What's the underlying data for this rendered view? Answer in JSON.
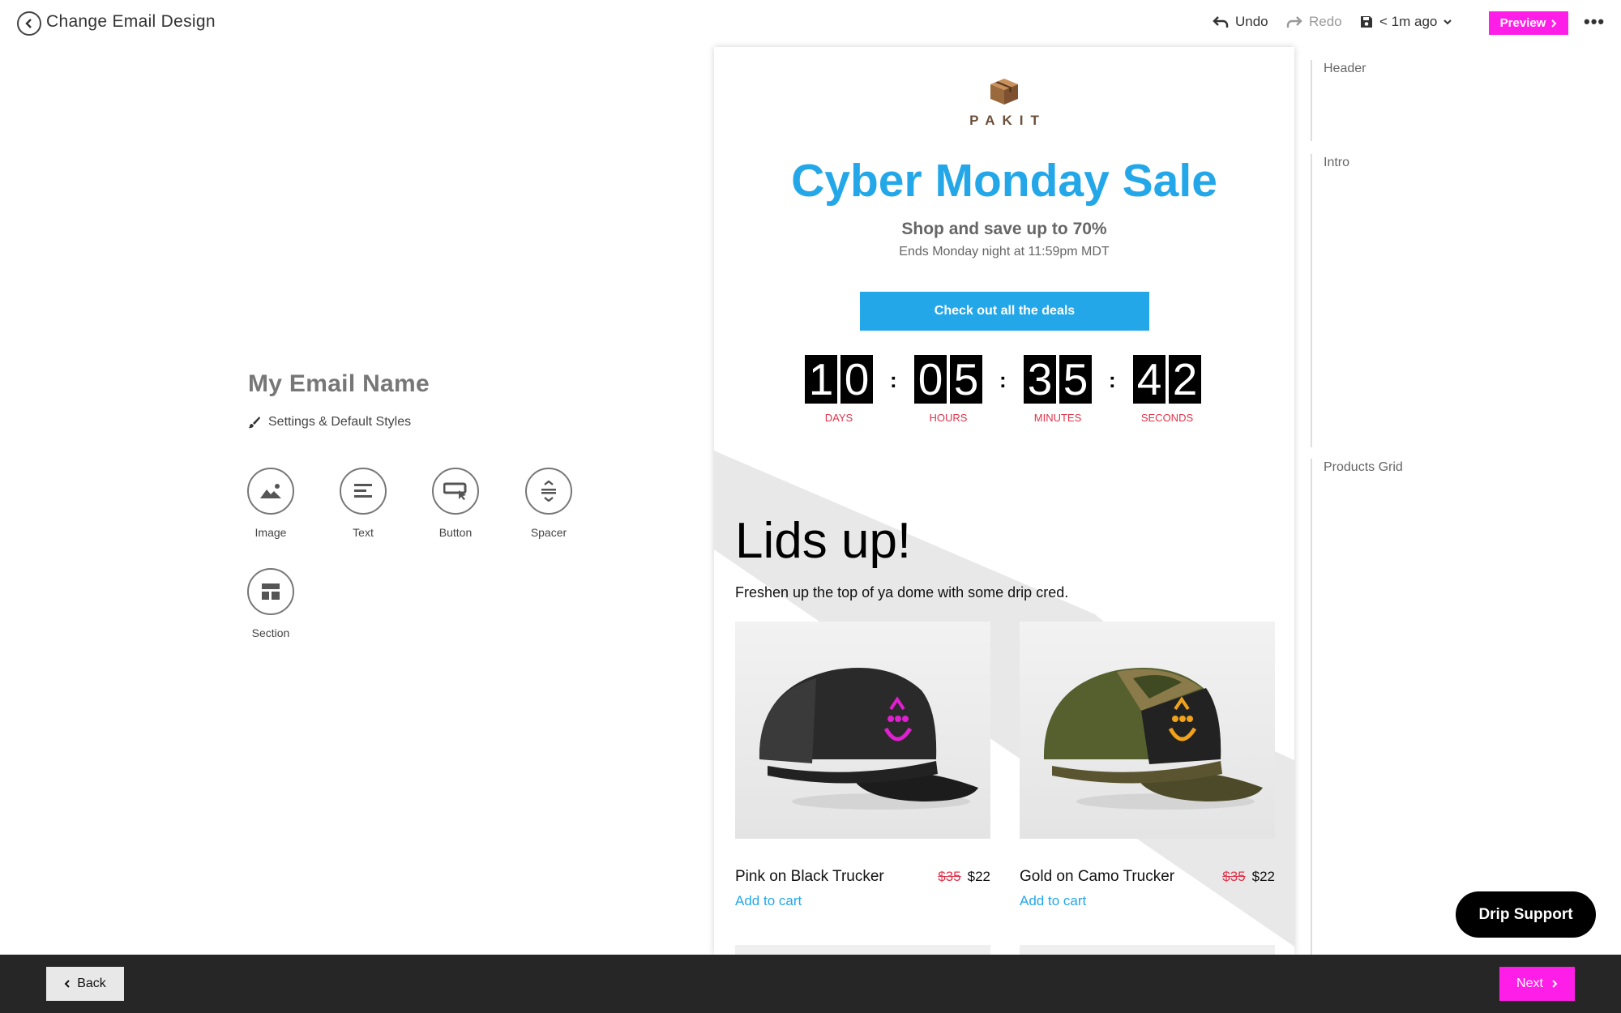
{
  "topbar": {
    "title": "Change Email Design",
    "undo_label": "Undo",
    "redo_label": "Redo",
    "saved_label": "< 1m ago",
    "preview_label": "Preview",
    "more_label": "•••"
  },
  "editor": {
    "email_name": "My Email Name",
    "settings_label": "Settings & Default Styles",
    "tools": [
      {
        "label": "Image",
        "icon": "image-icon"
      },
      {
        "label": "Text",
        "icon": "text-icon"
      },
      {
        "label": "Button",
        "icon": "button-icon"
      },
      {
        "label": "Spacer",
        "icon": "spacer-icon"
      },
      {
        "label": "Section",
        "icon": "section-icon"
      }
    ]
  },
  "email": {
    "logo_text": "PAKIT",
    "hero_title": "Cyber Monday Sale",
    "hero_subtitle": "Shop and save up to 70%",
    "hero_note": "Ends Monday night at 11:59pm MDT",
    "cta_label": "Check out all the deals",
    "countdown": [
      {
        "digits": [
          "1",
          "0"
        ],
        "label": "DAYS"
      },
      {
        "digits": [
          "0",
          "5"
        ],
        "label": "HOURS"
      },
      {
        "digits": [
          "3",
          "5"
        ],
        "label": "MINUTES"
      },
      {
        "digits": [
          "4",
          "2"
        ],
        "label": "SECONDS"
      }
    ],
    "colon": ":",
    "section_title": "Lids up!",
    "section_subtitle": "Freshen up the top of ya dome with some drip cred.",
    "products": [
      {
        "name": "Pink on Black Trucker",
        "old_price": "$35",
        "price": "$22",
        "cta": "Add to cart",
        "accent": "#e01fd0"
      },
      {
        "name": "Gold on Camo Trucker",
        "old_price": "$35",
        "price": "$22",
        "cta": "Add to cart",
        "accent": "#f0a21a"
      }
    ]
  },
  "outline": {
    "items": [
      "Header",
      "Intro",
      "Products Grid"
    ]
  },
  "support_label": "Drip Support",
  "footer": {
    "back_label": "Back",
    "next_label": "Next"
  },
  "colors": {
    "accent_pink": "#ff1ee8",
    "accent_blue": "#24a7e8",
    "countdown_label": "#e0334a"
  }
}
